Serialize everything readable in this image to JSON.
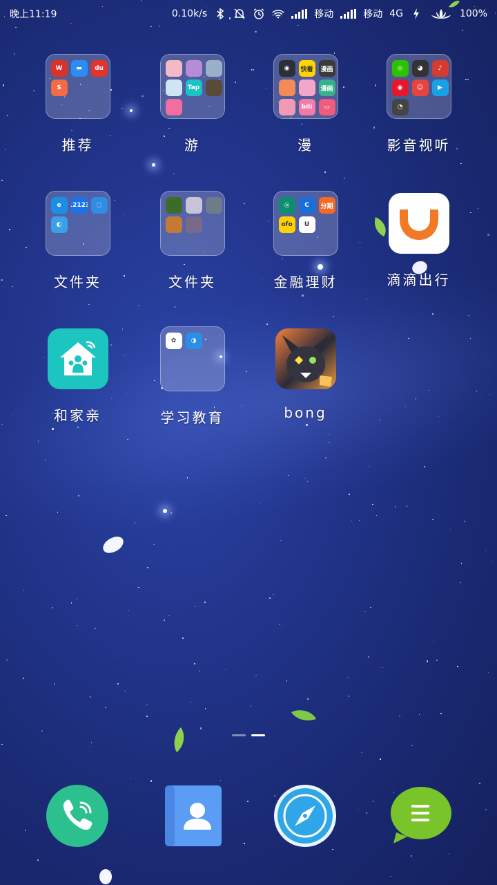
{
  "status_bar": {
    "time": "晚上11:19",
    "net_speed": "0.10k/s",
    "carrier1": "移动",
    "carrier2": "移动",
    "network_type": "4G",
    "battery": "100%"
  },
  "apps": [
    {
      "label": "推荐",
      "type": "folder",
      "minis": [
        {
          "t": "W",
          "c": "#d9322b",
          "icon": "wps-icon"
        },
        {
          "t": "▬",
          "c": "#2c8cf4",
          "icon": "chat-bubbles-icon"
        },
        {
          "t": "du",
          "c": "#e5322b",
          "icon": "du-icon"
        },
        {
          "t": "$",
          "c": "#f26b45",
          "icon": "money-bag-icon"
        }
      ]
    },
    {
      "label": "游",
      "type": "folder",
      "minis": [
        {
          "t": "",
          "c": "#f4b9c6",
          "icon": "anime-game-icon"
        },
        {
          "t": "",
          "c": "#b78bd6",
          "icon": "anime-game-icon"
        },
        {
          "t": "",
          "c": "#9ab0c8",
          "icon": "anime-game-icon"
        },
        {
          "t": "",
          "c": "#cfe5f5",
          "icon": "anime-game-icon"
        },
        {
          "t": "Tap",
          "c": "#19c3c7",
          "icon": "taptap-icon"
        },
        {
          "t": "",
          "c": "#5a4a3a",
          "icon": "anime-game-icon"
        },
        {
          "t": "",
          "c": "#f06fa0",
          "icon": "anime-game-icon"
        }
      ]
    },
    {
      "label": "漫",
      "type": "folder",
      "minis": [
        {
          "t": "◉",
          "c": "#2b2f38",
          "icon": "comic-icon"
        },
        {
          "t": "快看",
          "c": "#ffd400",
          "icon": "kuaikan-icon"
        },
        {
          "t": "漫画",
          "c": "#3a3a3a",
          "icon": "comic-icon"
        },
        {
          "t": "",
          "c": "#f28a5a",
          "icon": "comic-icon"
        },
        {
          "t": "",
          "c": "#f4a6c8",
          "icon": "comic-icon"
        },
        {
          "t": "漫画",
          "c": "#37b38c",
          "icon": "comic-icon"
        },
        {
          "t": "",
          "c": "#f09ab5",
          "icon": "comic-icon"
        },
        {
          "t": "bili",
          "c": "#f47ba6",
          "icon": "bilibili-icon"
        },
        {
          "t": "▭",
          "c": "#f05c7c",
          "icon": "comic-icon"
        }
      ]
    },
    {
      "label": "影音视听",
      "type": "folder",
      "minis": [
        {
          "t": "◎",
          "c": "#2dc100",
          "icon": "wechat-icon"
        },
        {
          "t": "◕",
          "c": "#333333",
          "icon": "qq-icon"
        },
        {
          "t": "♪",
          "c": "#d43c33",
          "icon": "netease-music-icon"
        },
        {
          "t": "◉",
          "c": "#e6162d",
          "icon": "weibo-icon"
        },
        {
          "t": "☺",
          "c": "#e8433e",
          "icon": "face-icon"
        },
        {
          "t": "▶",
          "c": "#19a0e5",
          "icon": "tencent-video-icon"
        },
        {
          "t": "◔",
          "c": "#444444",
          "icon": "qq-icon"
        }
      ]
    },
    {
      "label": "文件夹",
      "type": "folder",
      "minis": [
        {
          "t": "e",
          "c": "#1b8fe6",
          "icon": "browser-icon"
        },
        {
          "t": "12123",
          "c": "#1a73e8",
          "icon": "traffic-icon"
        },
        {
          "t": "◌",
          "c": "#2f8de4",
          "icon": "signal-icon"
        },
        {
          "t": "◐",
          "c": "#3aa0e8",
          "icon": "china-mobile-icon"
        }
      ]
    },
    {
      "label": "文件夹",
      "type": "folder",
      "minis": [
        {
          "t": "",
          "c": "#3d6b2a",
          "icon": "game-icon"
        },
        {
          "t": "",
          "c": "#c9c3d8",
          "icon": "game-icon"
        },
        {
          "t": "",
          "c": "#6f7b88",
          "icon": "game-icon"
        },
        {
          "t": "",
          "c": "#c47a35",
          "icon": "game-icon"
        },
        {
          "t": "",
          "c": "#7a6a8a",
          "icon": "game-icon"
        }
      ]
    },
    {
      "label": "金融理财",
      "type": "folder",
      "minis": [
        {
          "t": "◎",
          "c": "#0b8f6d",
          "icon": "bank-icon"
        },
        {
          "t": "C",
          "c": "#1a6fd6",
          "icon": "finance-icon"
        },
        {
          "t": "分期",
          "c": "#f26a24",
          "icon": "installment-icon"
        },
        {
          "t": "ofo",
          "c": "#ffd200",
          "icon": "ofo-icon"
        },
        {
          "t": "U",
          "c": "#ffffff",
          "icon": "u-icon"
        }
      ]
    },
    {
      "label": "滴滴出行",
      "type": "app",
      "icon": "didi-icon"
    },
    {
      "label": "和家亲",
      "type": "app",
      "icon": "home-family-icon"
    },
    {
      "label": "学习教育",
      "type": "folder",
      "minis": [
        {
          "t": "✿",
          "c": "#ffffff",
          "icon": "lotus-icon"
        },
        {
          "t": "◑",
          "c": "#2b8ee8",
          "icon": "education-icon"
        }
      ]
    },
    {
      "label": "bong",
      "type": "app",
      "icon": "bong-game-icon"
    }
  ],
  "dock": [
    {
      "name": "phone-app",
      "icon": "phone-icon",
      "color": "#2dc08f"
    },
    {
      "name": "contacts-app",
      "icon": "contacts-icon",
      "color": "#5b9cf5"
    },
    {
      "name": "browser-app",
      "icon": "compass-icon",
      "color": "#2ea6e8"
    },
    {
      "name": "messages-app",
      "icon": "message-icon",
      "color": "#79c42a"
    }
  ],
  "colors": {
    "didi_orange": "#f07a26",
    "home_teal": "#1cc5c0",
    "pager_active": "#ffffff",
    "pager_inactive": "rgba(255,255,255,0.45)"
  }
}
